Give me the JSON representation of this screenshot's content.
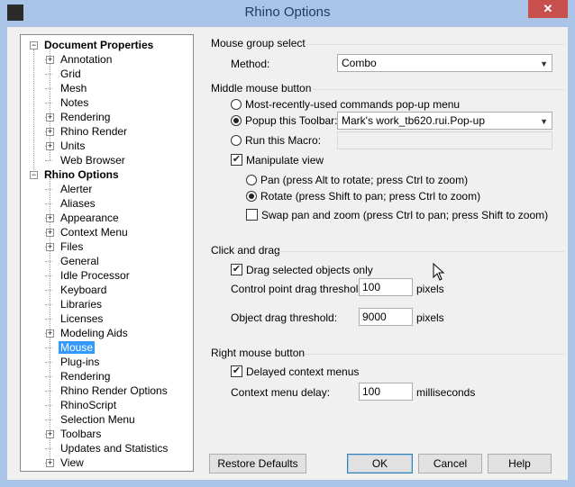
{
  "window": {
    "title": "Rhino Options",
    "close_glyph": "✕",
    "icon": "rhino-app-icon"
  },
  "tree": {
    "expander_collapse": "−",
    "expander_expand": "+",
    "items": [
      {
        "label": "Document Properties",
        "level": 0,
        "bold": true,
        "expander": "minus"
      },
      {
        "label": "Annotation",
        "level": 1,
        "expander": "plus"
      },
      {
        "label": "Grid",
        "level": 1
      },
      {
        "label": "Mesh",
        "level": 1
      },
      {
        "label": "Notes",
        "level": 1
      },
      {
        "label": "Rendering",
        "level": 1,
        "expander": "plus"
      },
      {
        "label": "Rhino Render",
        "level": 1,
        "expander": "plus"
      },
      {
        "label": "Units",
        "level": 1,
        "expander": "plus"
      },
      {
        "label": "Web Browser",
        "level": 1
      },
      {
        "label": "Rhino Options",
        "level": 0,
        "bold": true,
        "expander": "minus"
      },
      {
        "label": "Alerter",
        "level": 1
      },
      {
        "label": "Aliases",
        "level": 1
      },
      {
        "label": "Appearance",
        "level": 1,
        "expander": "plus"
      },
      {
        "label": "Context Menu",
        "level": 1,
        "expander": "plus"
      },
      {
        "label": "Files",
        "level": 1,
        "expander": "plus"
      },
      {
        "label": "General",
        "level": 1
      },
      {
        "label": "Idle Processor",
        "level": 1
      },
      {
        "label": "Keyboard",
        "level": 1
      },
      {
        "label": "Libraries",
        "level": 1
      },
      {
        "label": "Licenses",
        "level": 1
      },
      {
        "label": "Modeling Aids",
        "level": 1,
        "expander": "plus"
      },
      {
        "label": "Mouse",
        "level": 1,
        "selected": true
      },
      {
        "label": "Plug-ins",
        "level": 1
      },
      {
        "label": "Rendering",
        "level": 1
      },
      {
        "label": "Rhino Render Options",
        "level": 1
      },
      {
        "label": "RhinoScript",
        "level": 1
      },
      {
        "label": "Selection Menu",
        "level": 1
      },
      {
        "label": "Toolbars",
        "level": 1,
        "expander": "plus"
      },
      {
        "label": "Updates and Statistics",
        "level": 1
      },
      {
        "label": "View",
        "level": 1,
        "expander": "plus"
      }
    ]
  },
  "mouse_group_select": {
    "heading": "Mouse group select",
    "method_label": "Method:",
    "method_value": "Combo"
  },
  "middle_mouse": {
    "heading": "Middle mouse button",
    "opt_recent": "Most-recently-used commands pop-up menu",
    "opt_popup": "Popup this Toolbar:",
    "popup_value": "Mark's work_tb620.rui.Pop-up",
    "opt_macro": "Run this Macro:",
    "macro_value": "",
    "selected_option": "popup",
    "manipulate_view_label": "Manipulate view",
    "manipulate_view_checked": true,
    "pan_label": "Pan (press Alt to rotate; press Ctrl to zoom)",
    "rotate_label": "Rotate (press Shift to pan; press Ctrl to zoom)",
    "view_mode": "rotate",
    "swap_label": "Swap pan and zoom (press Ctrl to pan; press Shift to zoom)",
    "swap_checked": false
  },
  "click_drag": {
    "heading": "Click and drag",
    "drag_selected_label": "Drag selected objects only",
    "drag_selected_checked": true,
    "cp_threshold_label": "Control point drag threshold:",
    "cp_threshold_value": "100",
    "cp_threshold_unit": "pixels",
    "obj_threshold_label": "Object drag threshold:",
    "obj_threshold_value": "9000",
    "obj_threshold_unit": "pixels"
  },
  "right_mouse": {
    "heading": "Right mouse button",
    "delayed_label": "Delayed context menus",
    "delayed_checked": true,
    "delay_label": "Context menu delay:",
    "delay_value": "100",
    "delay_unit": "milliseconds"
  },
  "buttons": {
    "restore": "Restore Defaults",
    "ok": "OK",
    "cancel": "Cancel",
    "help": "Help"
  },
  "glyphs": {
    "check": "✔",
    "dropdown": "▼"
  }
}
